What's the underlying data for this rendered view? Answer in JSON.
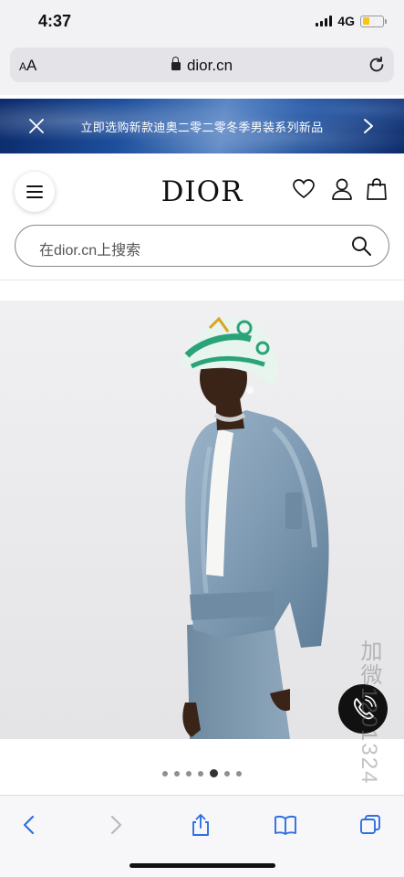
{
  "status_bar": {
    "time": "4:37",
    "network": "4G",
    "battery_level": 0.35,
    "battery_color": "#f5c518"
  },
  "browser": {
    "text_size_label": "AA",
    "url": "dior.cn"
  },
  "promo_banner": {
    "text": "立即选购新款迪奥二零二零冬季男装系列新品"
  },
  "header": {
    "logo": "DIOR",
    "icons": [
      "menu-icon",
      "heart-icon",
      "user-icon",
      "shopping-bag-icon"
    ]
  },
  "search": {
    "placeholder": "在dior.cn上搜索"
  },
  "carousel": {
    "total_slides": 7,
    "active_index": 4
  },
  "watermark": {
    "text": "加微1201324"
  },
  "toolbar": {
    "icons": [
      "back-icon",
      "forward-icon",
      "share-icon",
      "bookmarks-icon",
      "tabs-icon"
    ]
  },
  "colors": {
    "promo_gradient": "#1d4f9c",
    "jacket": "#7f9bb3",
    "hat_accent": "#2aa37a"
  }
}
